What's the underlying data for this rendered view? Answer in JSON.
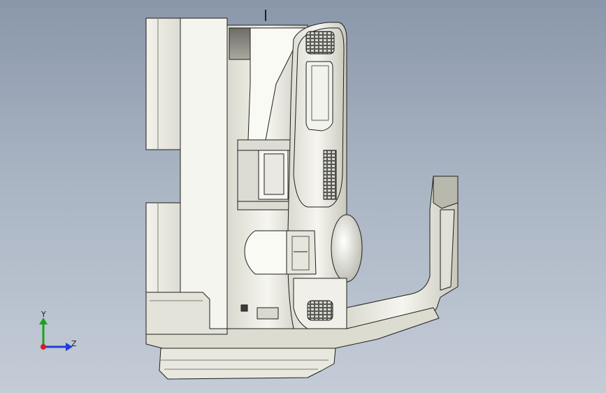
{
  "viewport": {
    "background_top": "#8a97aa",
    "background_bottom": "#c4ccd7",
    "model_face_color": "#ecece4",
    "model_edge_color": "#1e1e1e",
    "model_shade_color": "#c9c9bd"
  },
  "triad": {
    "y_label": "Y",
    "z_label": "Z",
    "y_color": "#1aa31a",
    "z_color": "#1f3fd6",
    "origin_color": "#d61f1f"
  }
}
